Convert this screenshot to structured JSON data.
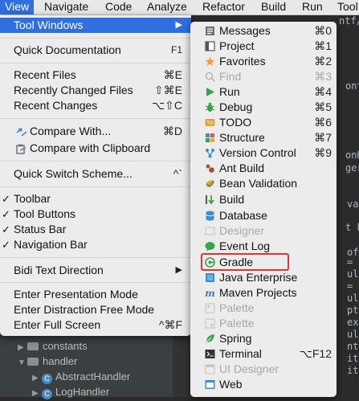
{
  "menubar": {
    "items": [
      "View",
      "Navigate",
      "Code",
      "Analyze",
      "Refactor",
      "Build",
      "Run",
      "Tool"
    ]
  },
  "view_menu": {
    "tool_windows": "Tool Windows",
    "quick_documentation": {
      "label": "Quick Documentation",
      "shortcut": "F1"
    },
    "recent_files": {
      "label": "Recent Files",
      "shortcut": "⌘E"
    },
    "recently_changed": {
      "label": "Recently Changed Files",
      "shortcut": "⇧⌘E"
    },
    "recent_changes": {
      "label": "Recent Changes",
      "shortcut": "⌥⇧C"
    },
    "compare_with": {
      "label": "Compare With...",
      "shortcut": "⌘D"
    },
    "compare_clipboard": {
      "label": "Compare with Clipboard"
    },
    "quick_switch": {
      "label": "Quick Switch Scheme...",
      "shortcut": "^`"
    },
    "toolbar": "Toolbar",
    "tool_buttons": "Tool Buttons",
    "status_bar": "Status Bar",
    "navigation_bar": "Navigation Bar",
    "bidi": "Bidi Text Direction",
    "presentation": "Enter Presentation Mode",
    "distraction": "Enter Distraction Free Mode",
    "full_screen": {
      "label": "Enter Full Screen",
      "shortcut": "^⌘F"
    }
  },
  "tool_windows_menu": {
    "messages": {
      "label": "Messages",
      "shortcut": "⌘0"
    },
    "project": {
      "label": "Project",
      "shortcut": "⌘1"
    },
    "favorites": {
      "label": "Favorites",
      "shortcut": "⌘2"
    },
    "find": {
      "label": "Find",
      "shortcut": "⌘3"
    },
    "run": {
      "label": "Run",
      "shortcut": "⌘4"
    },
    "debug": {
      "label": "Debug",
      "shortcut": "⌘5"
    },
    "todo": {
      "label": "TODO",
      "shortcut": "⌘6"
    },
    "structure": {
      "label": "Structure",
      "shortcut": "⌘7"
    },
    "version_control": {
      "label": "Version Control",
      "shortcut": "⌘9"
    },
    "ant_build": {
      "label": "Ant Build"
    },
    "bean_validation": {
      "label": "Bean Validation"
    },
    "build": {
      "label": "Build"
    },
    "database": {
      "label": "Database"
    },
    "designer": {
      "label": "Designer"
    },
    "event_log": {
      "label": "Event Log"
    },
    "gradle": {
      "label": "Gradle"
    },
    "java_enterprise": {
      "label": "Java Enterprise"
    },
    "maven": {
      "label": "Maven Projects"
    },
    "palette1": {
      "label": "Palette"
    },
    "palette2": {
      "label": "Palette"
    },
    "spring": {
      "label": "Spring"
    },
    "terminal": {
      "label": "Terminal",
      "shortcut": "⌥F12"
    },
    "ui_designer": {
      "label": "UI Designer"
    },
    "web": {
      "label": "Web"
    }
  },
  "project_tree": {
    "constants": "constants",
    "handler": "handler",
    "abstract_handler": "AbstractHandler",
    "log_handler": "LogHandler"
  },
  "code_fragments": [
    "ntf/r",
    "onte",
    "onH",
    "ger",
    "val",
    "t h",
    "of",
    "=",
    "ult",
    "=",
    "ult",
    "pti",
    "ex",
    "ult",
    "nt",
    "ity",
    "ity"
  ],
  "colors": {
    "highlight": "#2f6fde",
    "gradle_box": "#e0343c",
    "menu_bg": "#ececec"
  }
}
